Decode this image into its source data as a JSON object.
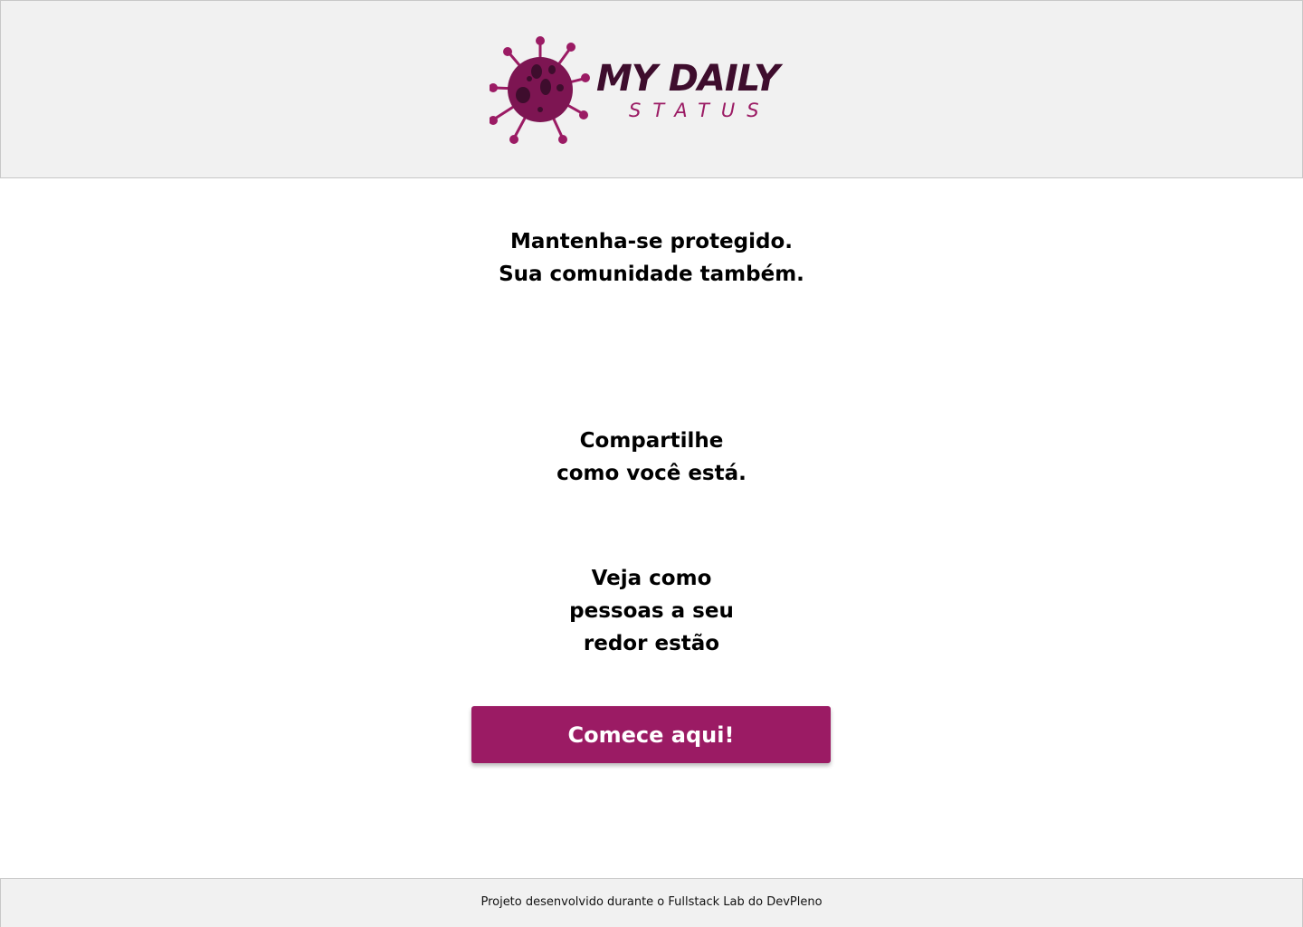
{
  "header": {
    "logo": {
      "title": "MY DAILY",
      "subtitle": "STATUS",
      "icon": "virus-icon"
    }
  },
  "main": {
    "taglines": [
      {
        "lines": [
          "Mantenha-se protegido.",
          "Sua comunidade também."
        ]
      },
      {
        "lines": [
          "Compartilhe",
          "como você está."
        ]
      },
      {
        "lines": [
          "Veja como",
          "pessoas a seu",
          "redor estão"
        ]
      }
    ],
    "cta_label": "Comece aqui!"
  },
  "footer": {
    "text": "Projeto desenvolvido durante o Fullstack Lab do DevPleno"
  },
  "colors": {
    "brand": "#9b1b64",
    "brand_dark": "#3e0d2d",
    "header_bg": "#f1f1f1"
  }
}
